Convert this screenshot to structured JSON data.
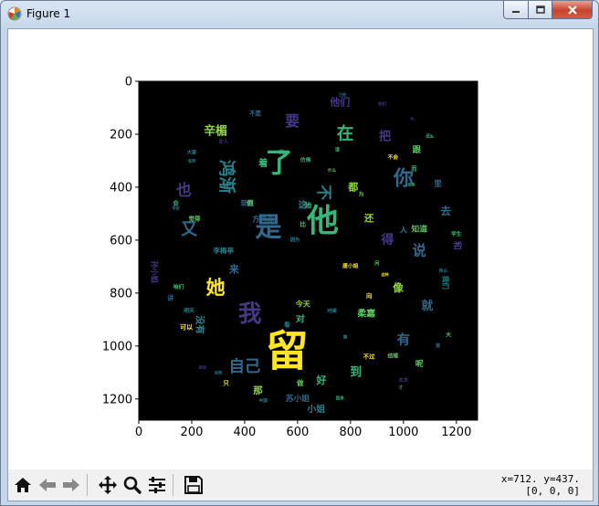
{
  "window": {
    "title": "Figure 1"
  },
  "axes": {
    "x_ticks": [
      "0",
      "200",
      "400",
      "600",
      "800",
      "1000",
      "1200"
    ],
    "y_ticks": [
      "0",
      "200",
      "400",
      "600",
      "800",
      "1000",
      "1200"
    ]
  },
  "palette": [
    "#440154",
    "#3b528b",
    "#21918c",
    "#5ec962",
    "#fde725",
    "#35b779",
    "#31688e",
    "#443983",
    "#90d743",
    "#26828e"
  ],
  "wordcloud": {
    "words": [
      {
        "text": "留",
        "color": "#fde725"
      },
      {
        "text": "他",
        "color": "#35b779"
      },
      {
        "text": "是",
        "color": "#31688e"
      },
      {
        "text": "了",
        "color": "#35b779"
      },
      {
        "text": "我",
        "color": "#443983"
      },
      {
        "text": "她",
        "color": "#fde725"
      },
      {
        "text": "你",
        "color": "#31688e"
      },
      {
        "text": "鸿渐",
        "color": "#26828e"
      },
      {
        "text": "说",
        "color": "#31688e"
      },
      {
        "text": "在",
        "color": "#35b779"
      },
      {
        "text": "也",
        "color": "#443983"
      },
      {
        "text": "又",
        "color": "#31688e"
      },
      {
        "text": "自己",
        "color": "#31688e"
      },
      {
        "text": "有",
        "color": "#31688e"
      },
      {
        "text": "不",
        "color": "#26828e"
      },
      {
        "text": "要",
        "color": "#443983"
      },
      {
        "text": "就",
        "color": "#31688e"
      },
      {
        "text": "得",
        "color": "#443983"
      },
      {
        "text": "到",
        "color": "#35b779"
      },
      {
        "text": "辛楣",
        "color": "#90d743"
      },
      {
        "text": "把",
        "color": "#443983"
      },
      {
        "text": "都",
        "color": "#90d743"
      },
      {
        "text": "像",
        "color": "#90d743"
      },
      {
        "text": "没有",
        "color": "#26828e"
      },
      {
        "text": "他们",
        "color": "#443983"
      },
      {
        "text": "去",
        "color": "#31688e"
      },
      {
        "text": "和",
        "color": "#443983"
      },
      {
        "text": "来",
        "color": "#31688e"
      },
      {
        "text": "还",
        "color": "#90d743"
      },
      {
        "text": "好",
        "color": "#35b779"
      },
      {
        "text": "小姐",
        "color": "#26828e"
      },
      {
        "text": "柔嘉",
        "color": "#5ec962"
      },
      {
        "text": "那",
        "color": "#90d743"
      },
      {
        "text": "跟",
        "color": "#5ec962"
      },
      {
        "text": "这",
        "color": "#26828e"
      },
      {
        "text": "着",
        "color": "#35b779"
      },
      {
        "text": "里",
        "color": "#31688e"
      },
      {
        "text": "知道",
        "color": "#5ec962"
      },
      {
        "text": "人",
        "color": "#26828e"
      },
      {
        "text": "方鸿渐",
        "color": "#31688e"
      },
      {
        "text": "李梅亭",
        "color": "#26828e"
      },
      {
        "text": "苏小姐",
        "color": "#31688e"
      },
      {
        "text": "孙小姐",
        "color": "#443983"
      },
      {
        "text": "我们",
        "color": "#26828e"
      },
      {
        "text": "可以",
        "color": "#fde725"
      },
      {
        "text": "今天",
        "color": "#90d743"
      },
      {
        "text": "对",
        "color": "#35b779"
      },
      {
        "text": "做",
        "color": "#5ec962"
      },
      {
        "text": "呢",
        "color": "#5ec962"
      },
      {
        "text": "地",
        "color": "#35b779"
      },
      {
        "text": "现在",
        "color": "#31688e"
      },
      {
        "text": "觉得",
        "color": "#5ec962"
      },
      {
        "text": "大家",
        "color": "#26828e"
      },
      {
        "text": "女人",
        "color": "#443983"
      },
      {
        "text": "学生",
        "color": "#35b779"
      },
      {
        "text": "唐小姐",
        "color": "#fde725"
      },
      {
        "text": "这样",
        "color": "#443983"
      },
      {
        "text": "所以",
        "color": "#26828e"
      },
      {
        "text": "不会",
        "color": "#fde725"
      },
      {
        "text": "仿佛",
        "color": "#35b779"
      },
      {
        "text": "而",
        "color": "#35b779"
      },
      {
        "text": "时候",
        "color": "#26828e"
      },
      {
        "text": "只",
        "color": "#fde725"
      },
      {
        "text": "讲",
        "color": "#31688e"
      },
      {
        "text": "会",
        "color": "#35b779"
      },
      {
        "text": "明天",
        "color": "#26828e"
      },
      {
        "text": "咱们",
        "color": "#35b779"
      },
      {
        "text": "不是",
        "color": "#31688e"
      },
      {
        "text": "向",
        "color": "#fde725"
      },
      {
        "text": "因为",
        "color": "#26828e"
      },
      {
        "text": "比",
        "color": "#5ec962"
      },
      {
        "text": "倒",
        "color": "#5ec962"
      },
      {
        "text": "看",
        "color": "#26828e"
      },
      {
        "text": "的",
        "color": "#35b779"
      },
      {
        "text": "才",
        "color": "#26828e"
      },
      {
        "text": "为",
        "color": "#5ec962"
      },
      {
        "text": "结婚",
        "color": "#5ec962"
      },
      {
        "text": "不过",
        "color": "#fde725"
      },
      {
        "text": "道",
        "color": "#31688e"
      },
      {
        "text": "大",
        "color": "#5ec962"
      },
      {
        "text": "太太",
        "color": "#443983"
      },
      {
        "text": "回来",
        "color": "#35b779"
      },
      {
        "text": "中国",
        "color": "#26828e"
      },
      {
        "text": "已经",
        "color": "#31688e"
      },
      {
        "text": "东西",
        "color": "#443983"
      },
      {
        "text": "问",
        "color": "#5ec962"
      },
      {
        "text": "这种",
        "color": "#fde725"
      },
      {
        "text": "说话",
        "color": "#443983"
      },
      {
        "text": "自然",
        "color": "#26828e"
      },
      {
        "text": "请",
        "color": "#35b779"
      },
      {
        "text": "什么",
        "color": "#5ec962"
      },
      {
        "text": "还是",
        "color": "#35b779"
      },
      {
        "text": "你们",
        "color": "#443983"
      },
      {
        "text": "先生",
        "color": "#26828e"
      },
      {
        "text": "起来",
        "color": "#fde725"
      },
      {
        "text": "真",
        "color": "#fde725"
      },
      {
        "text": "第",
        "color": "#26828e"
      },
      {
        "text": "学校",
        "color": "#31688e"
      },
      {
        "text": "忽然",
        "color": "#26828e"
      },
      {
        "text": "出来",
        "color": "#35b779"
      }
    ]
  },
  "toolbar": {
    "buttons": [
      "home",
      "back",
      "forward",
      "pan",
      "zoom",
      "configure-subplots",
      "save"
    ]
  },
  "status": {
    "coords": "x=712. y=437.",
    "value": "[0, 0, 0]"
  }
}
